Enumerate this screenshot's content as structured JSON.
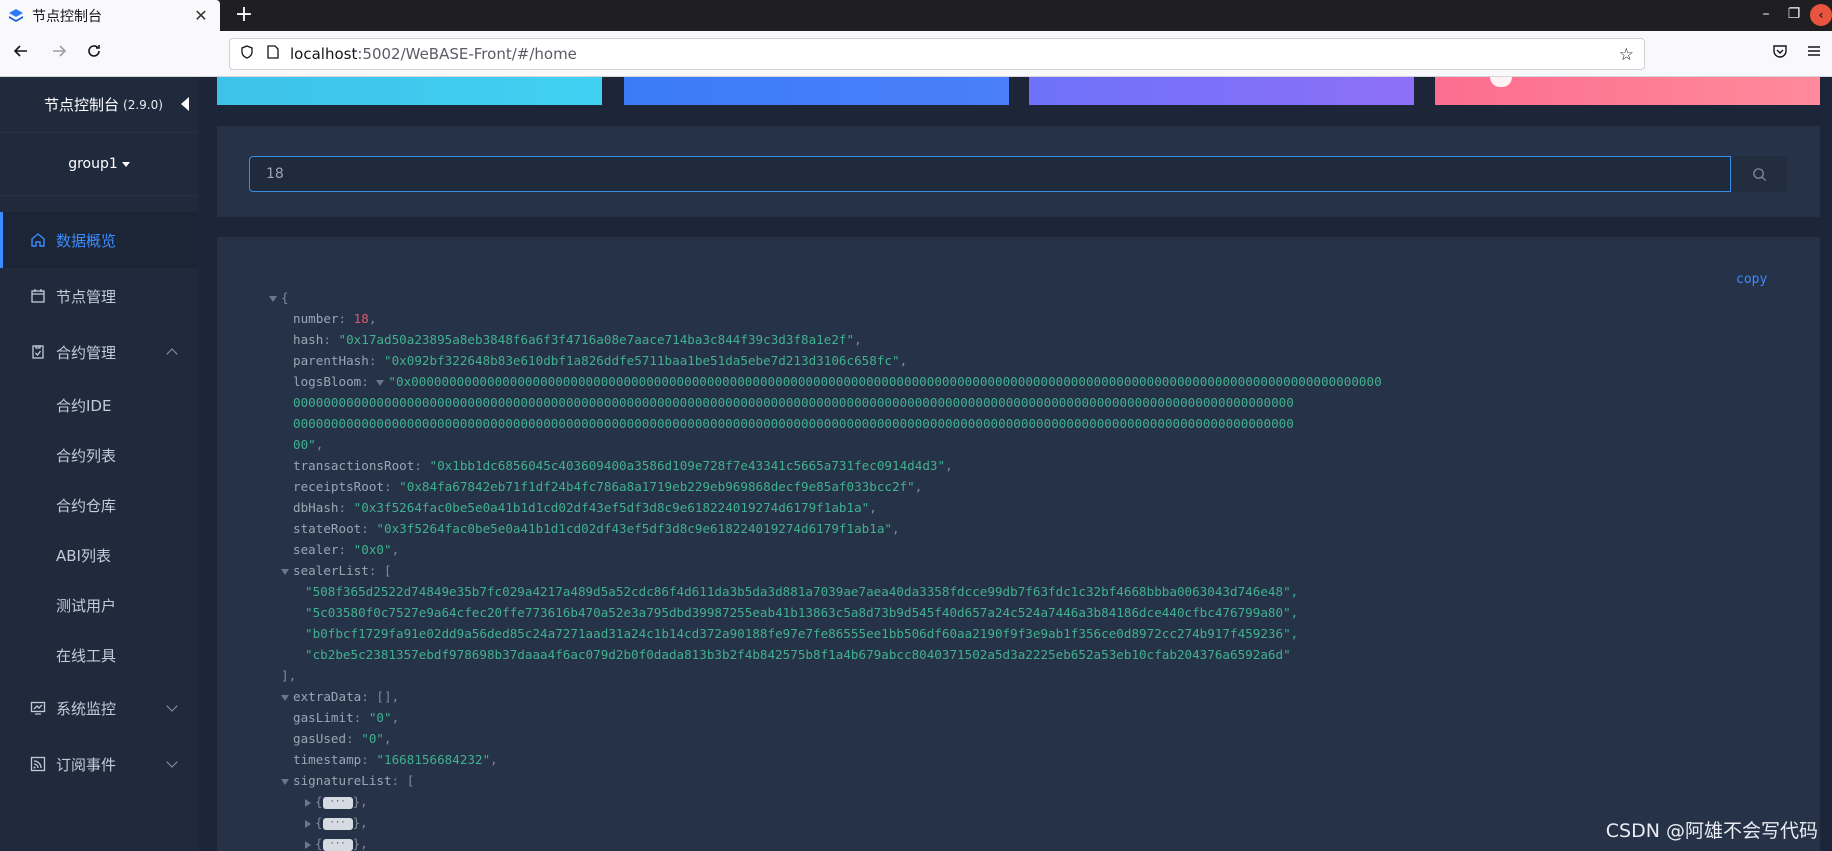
{
  "browser": {
    "tab_title": "节点控制台",
    "close_glyph": "✕",
    "new_tab_glyph": "+",
    "url_host": "localhost",
    "url_rest": ":5002/WeBASE-Front/#/home",
    "window_controls": [
      "–",
      "❐",
      "‹"
    ]
  },
  "sidebar": {
    "title": "节点控制台",
    "version": "(2.9.0)",
    "group": "group1",
    "items": [
      {
        "label": "数据概览",
        "icon": "home-icon"
      },
      {
        "label": "节点管理",
        "icon": "calendar-icon"
      },
      {
        "label": "合约管理",
        "icon": "clipboard-icon"
      },
      {
        "label": "系统监控",
        "icon": "monitor-icon"
      },
      {
        "label": "订阅事件",
        "icon": "rss-icon"
      }
    ],
    "contract_sub": [
      "合约IDE",
      "合约列表",
      "合约仓库",
      "ABI列表",
      "测试用户",
      "在线工具"
    ]
  },
  "search": {
    "value": "18"
  },
  "json_view": {
    "copy_label": "copy",
    "open_brace": "{",
    "number_key": "number",
    "number_value": "18",
    "hash": "\"0x17ad50a23895a8eb3848f6a6f3f4716a08e7aace714ba3c844f39c3d3f8a1e2f\"",
    "parentHash": "\"0x092bf322648b83e610dbf1a826ddfe5711baa1be51da5ebe7d213d3106c658fc\"",
    "logsBloom_1": "\"0x00000000000000000000000000000000000000000000000000000000000000000000000000000000000000000000000000000000000000000000000000000000",
    "logsBloom_2": "000000000000000000000000000000000000000000000000000000000000000000000000000000000000000000000000000000000000000000000000000000000000",
    "logsBloom_3": "000000000000000000000000000000000000000000000000000000000000000000000000000000000000000000000000000000000000000000000000000000000000",
    "logsBloom_4": "00\"",
    "transactionsRoot": "\"0x1bb1dc6856045c403609400a3586d109e728f7e43341c5665a731fec0914d4d3\"",
    "receiptsRoot": "\"0x84fa67842eb71f1df24b4fc786a8a1719eb229eb969868decf9e85af033bcc2f\"",
    "dbHash": "\"0x3f5264fac0be5e0a41b1d1cd02df43ef5df3d8c9e618224019274d6179f1ab1a\"",
    "stateRoot": "\"0x3f5264fac0be5e0a41b1d1cd02df43ef5df3d8c9e618224019274d6179f1ab1a\"",
    "sealer": "\"0x0\"",
    "sealerList": [
      "\"508f365d2522d74849e35b7fc029a4217a489d5a52cdc86f4d611da3b5da3d881a7039ae7aea40da3358fdcce99db7f63fdc1c32bf4668bbba0063043d746e48\",",
      "\"5c03580f0c7527e9a64cfec20ffe773616b470a52e3a795dbd39987255eab41b13863c5a8d73b9d545f40d657a24c524a7446a3b84186dce440cfbc476799a80\",",
      "\"b0fbcf1729fa91e02dd9a56ded85c24a7271aad31a24c1b14cd372a90188fe97e7fe86555ee1bb506df60aa2190f9f3e9ab1f356ce0d8972cc274b917f459236\",",
      "\"cb2be5c2381357ebdf978698b37daaa4f6ac079d2b0f0dada813b3b2f4b842575b8f1a4b679abcc8040371502a5d3a2225eb652a53eb10cfab204376a6592a6d\""
    ],
    "extraData": "[]",
    "gasLimit": "\"0\"",
    "gasUsed": "\"0\"",
    "timestamp": "\"1668156684232\"",
    "signatureList_open": "[",
    "close_bracket": "],",
    "ellipsis": "···"
  },
  "watermark": "CSDN @阿雄不会写代码",
  "colors": {
    "accent": "#3b8cff",
    "string": "#40b18f",
    "number": "#e0566f",
    "panel": "#263248"
  }
}
